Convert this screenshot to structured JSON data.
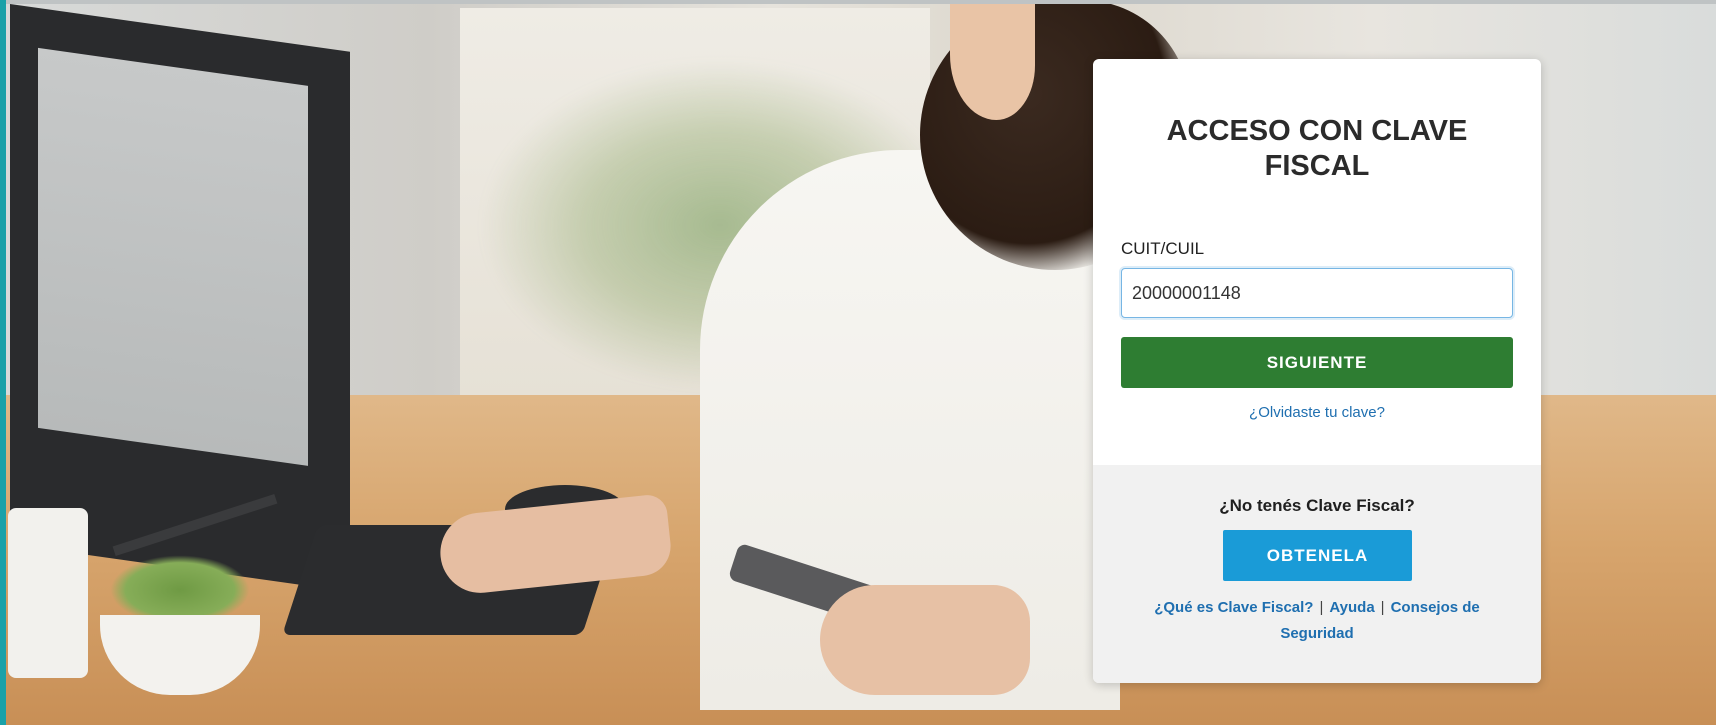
{
  "login": {
    "title": "ACCESO CON CLAVE FISCAL",
    "field_label": "CUIT/CUIL",
    "cuit_value": "20000001148",
    "next_button": "SIGUIENTE",
    "forgot_link": "¿Olvidaste tu clave?"
  },
  "register": {
    "prompt": "¿No tenés Clave Fiscal?",
    "get_button": "OBTENELA",
    "links": {
      "what_is": "¿Qué es Clave Fiscal?",
      "separator": "|",
      "help": "Ayuda",
      "security": "Consejos de Seguridad"
    }
  },
  "colors": {
    "next_button_bg": "#2e7d32",
    "get_button_bg": "#1a9bd7",
    "link": "#1f6fb0",
    "input_border": "#77b6e4",
    "accent_edge": "#1aa1a8"
  }
}
